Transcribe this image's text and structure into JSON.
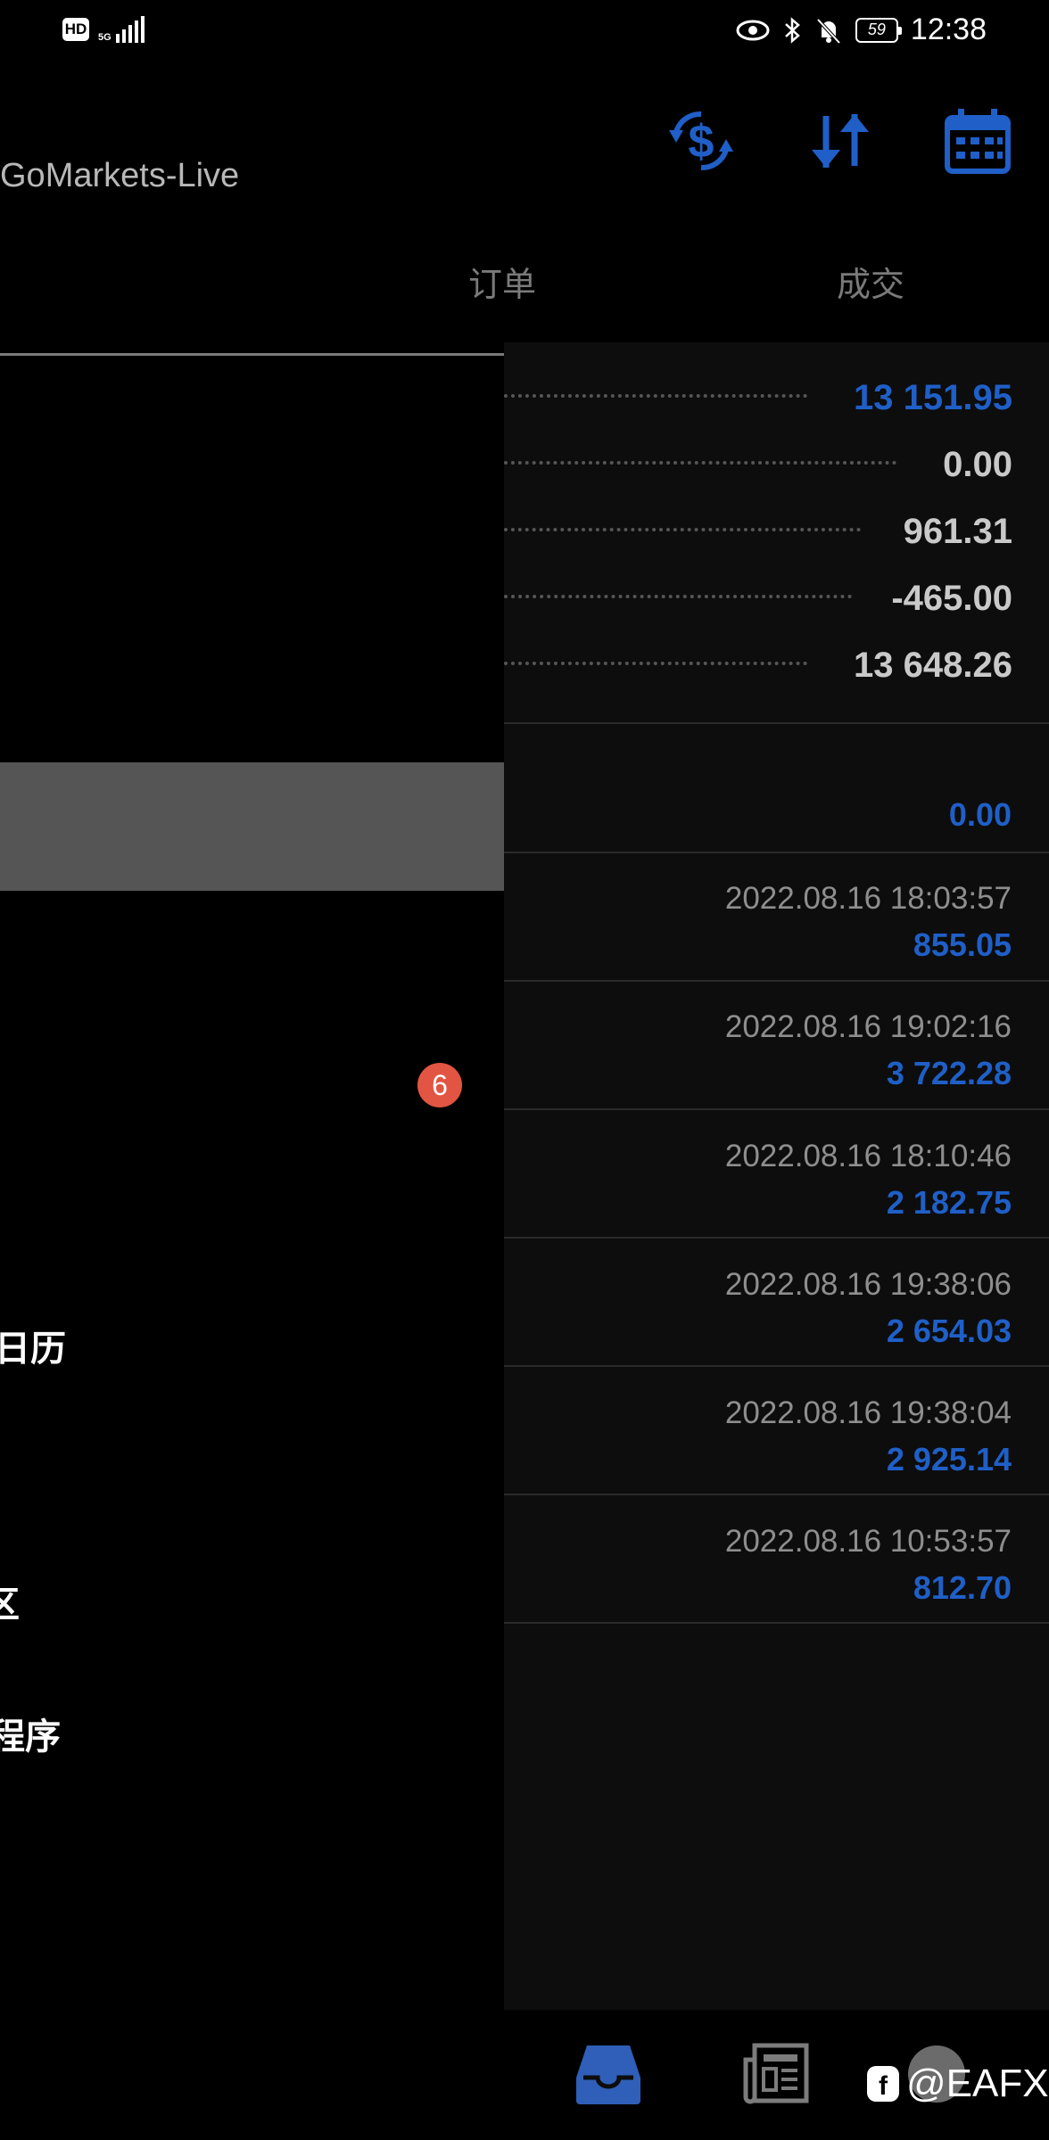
{
  "status_bar": {
    "hd": "HD",
    "network": "5G",
    "battery": "59",
    "time": "12:38"
  },
  "header": {
    "account_title": "GoMarkets-Live",
    "icons": [
      "currency-exchange-icon",
      "sort-icon",
      "calendar-icon"
    ],
    "accent_color": "#1f5fc7"
  },
  "tabs": [
    {
      "label": "订单"
    },
    {
      "label": "成交"
    }
  ],
  "drawer": {
    "badge": "6",
    "items": [
      {
        "label": "日历"
      },
      {
        "label": "区"
      },
      {
        "label": "程序"
      }
    ]
  },
  "summary": [
    {
      "value": "13 151.95",
      "color": "blue"
    },
    {
      "value": "0.00",
      "color": "grey"
    },
    {
      "value": "961.31",
      "color": "grey"
    },
    {
      "value": "-465.00",
      "color": "grey"
    },
    {
      "value": "13 648.26",
      "color": "grey"
    }
  ],
  "balance_row": {
    "value": "0.00"
  },
  "deals": [
    {
      "date": "2022.08.16 18:03:57",
      "amount": "855.05"
    },
    {
      "date": "2022.08.16 19:02:16",
      "amount": "3 722.28"
    },
    {
      "date": "2022.08.16 18:10:46",
      "amount": "2 182.75"
    },
    {
      "date": "2022.08.16 19:38:06",
      "amount": "2 654.03"
    },
    {
      "date": "2022.08.16 19:38:04",
      "amount": "2 925.14"
    },
    {
      "date": "2022.08.16 10:53:57",
      "amount": "812.70"
    }
  ],
  "bottom_nav": {
    "icons": [
      "inbox-icon",
      "news-icon"
    ],
    "watermark": "@EAFX"
  }
}
